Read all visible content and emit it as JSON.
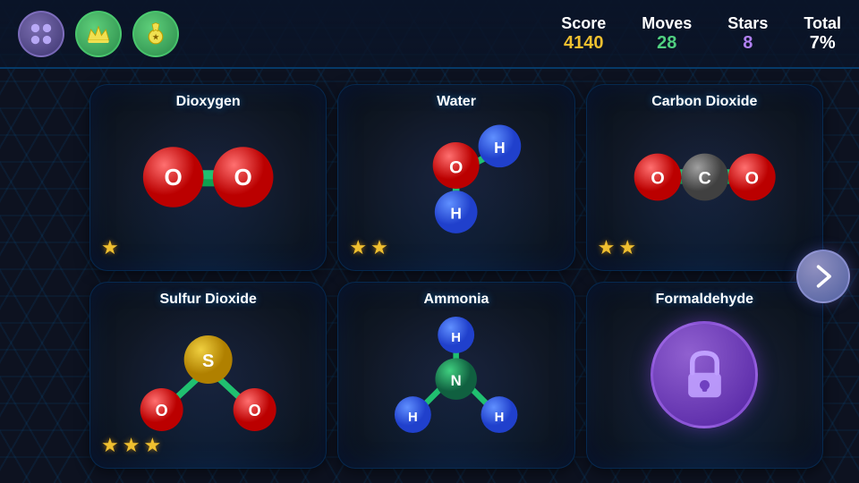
{
  "header": {
    "menu_label": "Menu",
    "crown_label": "Crown Badge",
    "medal_label": "Medal Badge",
    "stats": {
      "score_label": "Score",
      "score_value": "4140",
      "moves_label": "Moves",
      "moves_value": "28",
      "stars_label": "Stars",
      "stars_value": "8",
      "total_label": "Total",
      "total_value": "7%"
    }
  },
  "molecules": [
    {
      "id": "dioxygen",
      "title": "Dioxygen",
      "stars": 1,
      "locked": false
    },
    {
      "id": "water",
      "title": "Water",
      "stars": 2,
      "locked": false
    },
    {
      "id": "carbon_dioxide",
      "title": "Carbon Dioxide",
      "stars": 2,
      "locked": false
    },
    {
      "id": "sulfur_dioxide",
      "title": "Sulfur Dioxide",
      "stars": 3,
      "locked": false
    },
    {
      "id": "ammonia",
      "title": "Ammonia",
      "stars": 0,
      "locked": false
    },
    {
      "id": "formaldehyde",
      "title": "Formaldehyde",
      "stars": 0,
      "locked": true
    }
  ],
  "navigation": {
    "next_label": "Next"
  }
}
